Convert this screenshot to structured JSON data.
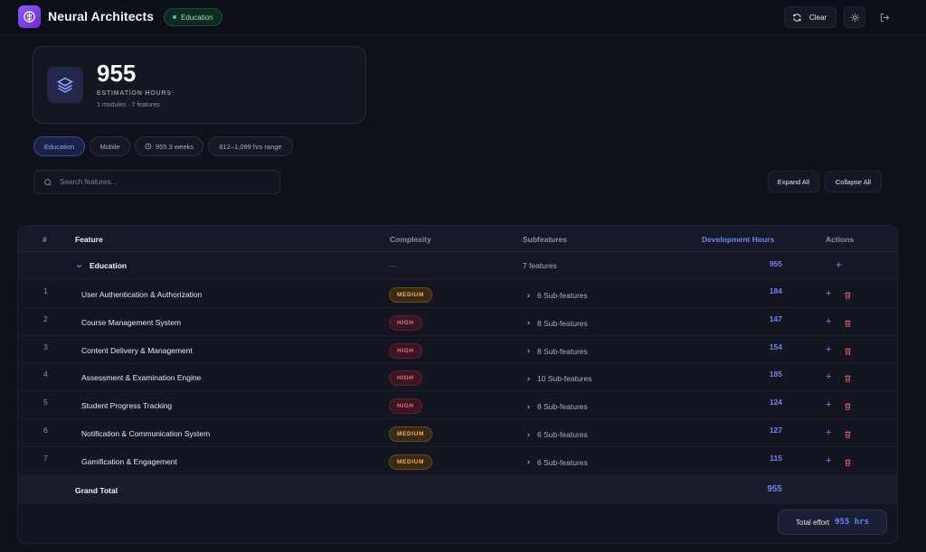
{
  "header": {
    "title": "Neural Architects",
    "domain_badge": "Education",
    "clear_label": "Clear",
    "logo_icon": "brain-icon",
    "theme_icon": "sun-icon",
    "logout_icon": "logout-icon"
  },
  "summary": {
    "value": "955",
    "caption": "ESTIMATION HOURS",
    "subtitle": "1 modules · 7 features",
    "icon": "layers-icon"
  },
  "chips": [
    {
      "label": "Education",
      "active": true
    },
    {
      "label": "Mobile",
      "active": false
    },
    {
      "label": "955.3 weeks",
      "active": false,
      "icon": "clock-icon"
    },
    {
      "label": "812–1,099 hrs range",
      "active": false
    }
  ],
  "search": {
    "placeholder": "Search features...",
    "value": ""
  },
  "toolbar": {
    "expand_all": "Expand All",
    "collapse_all": "Collapse All"
  },
  "table": {
    "headers": {
      "num": "#",
      "feature": "Feature",
      "complexity": "Complexity",
      "subfeatures": "Subfeatures",
      "hours": "Development Hours",
      "actions": "Actions"
    },
    "group": {
      "name": "Education",
      "complexity": "—",
      "subfeatures": "7 features",
      "hours": "955"
    },
    "rows": [
      {
        "num": "1",
        "feature": "User Authentication & Authorization",
        "complexity": "MEDIUM",
        "subfeatures": "6 Sub-features",
        "hours": "184"
      },
      {
        "num": "2",
        "feature": "Course Management System",
        "complexity": "HIGH",
        "subfeatures": "8 Sub-features",
        "hours": "147"
      },
      {
        "num": "3",
        "feature": "Content Delivery & Management",
        "complexity": "HIGH",
        "subfeatures": "8 Sub-features",
        "hours": "154"
      },
      {
        "num": "4",
        "feature": "Assessment & Examination Engine",
        "complexity": "HIGH",
        "subfeatures": "10 Sub-features",
        "hours": "185"
      },
      {
        "num": "5",
        "feature": "Student Progress Tracking",
        "complexity": "HIGH",
        "subfeatures": "8 Sub-features",
        "hours": "124"
      },
      {
        "num": "6",
        "feature": "Notification & Communication System",
        "complexity": "MEDIUM",
        "subfeatures": "6 Sub-features",
        "hours": "127"
      },
      {
        "num": "7",
        "feature": "Gamification & Engagement",
        "complexity": "MEDIUM",
        "subfeatures": "6 Sub-features",
        "hours": "115"
      }
    ],
    "grand_total": {
      "label": "Grand Total",
      "hours": "955"
    }
  },
  "total_effort": {
    "label": "Total effort",
    "value": "955 hrs"
  },
  "colors": {
    "accent": "#6d84f6",
    "medium": "#f0b45a",
    "high": "#f07082",
    "success": "#34d399"
  }
}
